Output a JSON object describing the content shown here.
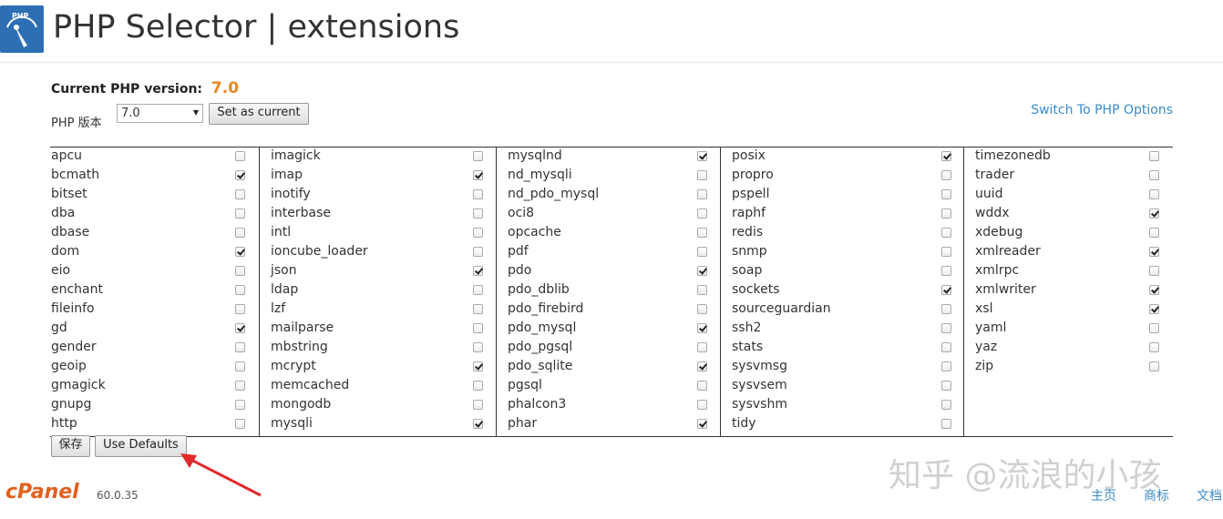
{
  "header": {
    "title": "PHP Selector | extensions",
    "logo_text": "PHP"
  },
  "current_version": {
    "label": "Current PHP version:",
    "value": "7.0"
  },
  "php_version_label": "PHP 版本",
  "version_select": {
    "value": "7.0"
  },
  "set_current_button": "Set as current",
  "switch_link": "Switch To PHP Options",
  "columns": [
    [
      {
        "name": "apcu",
        "checked": false
      },
      {
        "name": "bcmath",
        "checked": true
      },
      {
        "name": "bitset",
        "checked": false
      },
      {
        "name": "dba",
        "checked": false
      },
      {
        "name": "dbase",
        "checked": false
      },
      {
        "name": "dom",
        "checked": true
      },
      {
        "name": "eio",
        "checked": false
      },
      {
        "name": "enchant",
        "checked": false
      },
      {
        "name": "fileinfo",
        "checked": false
      },
      {
        "name": "gd",
        "checked": true
      },
      {
        "name": "gender",
        "checked": false
      },
      {
        "name": "geoip",
        "checked": false
      },
      {
        "name": "gmagick",
        "checked": false
      },
      {
        "name": "gnupg",
        "checked": false
      },
      {
        "name": "http",
        "checked": false
      }
    ],
    [
      {
        "name": "imagick",
        "checked": false
      },
      {
        "name": "imap",
        "checked": true
      },
      {
        "name": "inotify",
        "checked": false
      },
      {
        "name": "interbase",
        "checked": false
      },
      {
        "name": "intl",
        "checked": false
      },
      {
        "name": "ioncube_loader",
        "checked": false
      },
      {
        "name": "json",
        "checked": true
      },
      {
        "name": "ldap",
        "checked": false
      },
      {
        "name": "lzf",
        "checked": false
      },
      {
        "name": "mailparse",
        "checked": false
      },
      {
        "name": "mbstring",
        "checked": false
      },
      {
        "name": "mcrypt",
        "checked": true
      },
      {
        "name": "memcached",
        "checked": false
      },
      {
        "name": "mongodb",
        "checked": false
      },
      {
        "name": "mysqli",
        "checked": true
      }
    ],
    [
      {
        "name": "mysqlnd",
        "checked": true
      },
      {
        "name": "nd_mysqli",
        "checked": false
      },
      {
        "name": "nd_pdo_mysql",
        "checked": false
      },
      {
        "name": "oci8",
        "checked": false
      },
      {
        "name": "opcache",
        "checked": false
      },
      {
        "name": "pdf",
        "checked": false
      },
      {
        "name": "pdo",
        "checked": true
      },
      {
        "name": "pdo_dblib",
        "checked": false
      },
      {
        "name": "pdo_firebird",
        "checked": false
      },
      {
        "name": "pdo_mysql",
        "checked": true
      },
      {
        "name": "pdo_pgsql",
        "checked": false
      },
      {
        "name": "pdo_sqlite",
        "checked": true
      },
      {
        "name": "pgsql",
        "checked": false
      },
      {
        "name": "phalcon3",
        "checked": false
      },
      {
        "name": "phar",
        "checked": true
      }
    ],
    [
      {
        "name": "posix",
        "checked": true
      },
      {
        "name": "propro",
        "checked": false
      },
      {
        "name": "pspell",
        "checked": false
      },
      {
        "name": "raphf",
        "checked": false
      },
      {
        "name": "redis",
        "checked": false
      },
      {
        "name": "snmp",
        "checked": false
      },
      {
        "name": "soap",
        "checked": false
      },
      {
        "name": "sockets",
        "checked": true
      },
      {
        "name": "sourceguardian",
        "checked": false
      },
      {
        "name": "ssh2",
        "checked": false
      },
      {
        "name": "stats",
        "checked": false
      },
      {
        "name": "sysvmsg",
        "checked": false
      },
      {
        "name": "sysvsem",
        "checked": false
      },
      {
        "name": "sysvshm",
        "checked": false
      },
      {
        "name": "tidy",
        "checked": false
      }
    ],
    [
      {
        "name": "timezonedb",
        "checked": false
      },
      {
        "name": "trader",
        "checked": false
      },
      {
        "name": "uuid",
        "checked": false
      },
      {
        "name": "wddx",
        "checked": true
      },
      {
        "name": "xdebug",
        "checked": false
      },
      {
        "name": "xmlreader",
        "checked": true
      },
      {
        "name": "xmlrpc",
        "checked": false
      },
      {
        "name": "xmlwriter",
        "checked": true
      },
      {
        "name": "xsl",
        "checked": true
      },
      {
        "name": "yaml",
        "checked": false
      },
      {
        "name": "yaz",
        "checked": false
      },
      {
        "name": "zip",
        "checked": false
      }
    ]
  ],
  "save_button": "保存",
  "defaults_button": "Use Defaults",
  "footer": {
    "logo": "cPanel",
    "version": "60.0.35",
    "links": [
      "主页",
      "商标",
      "文档"
    ]
  },
  "watermark": "知乎 @流浪的小孩",
  "colors": {
    "accent_orange": "#e8871e",
    "link_blue": "#3a8ac7",
    "logo_blue": "#2d6fb5",
    "cpanel_orange": "#e0601f",
    "annotation_red": "#e02a2a"
  }
}
